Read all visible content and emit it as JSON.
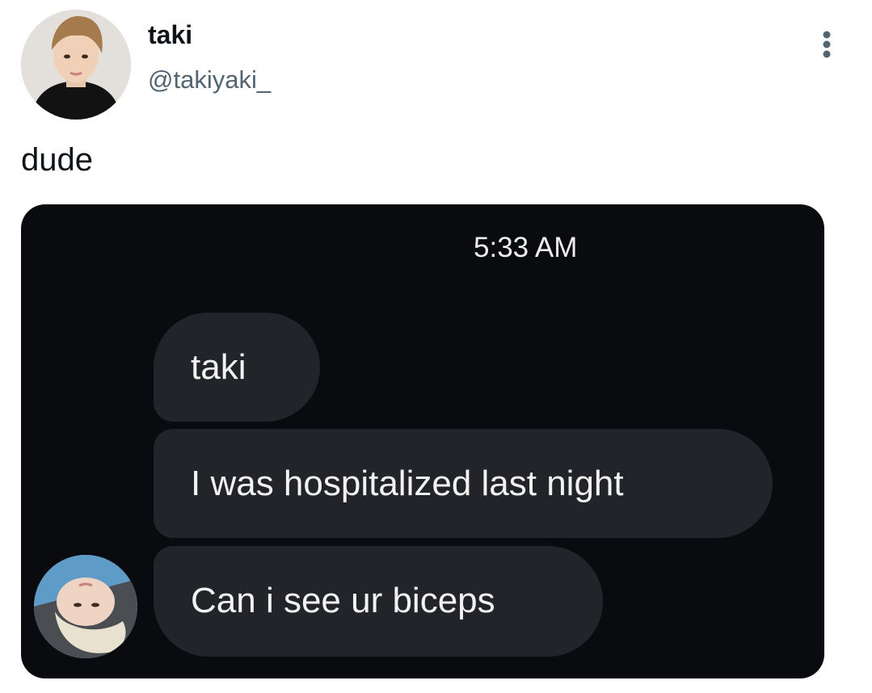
{
  "author": {
    "display_name": "taki",
    "handle": "@takiyaki_",
    "avatar_icon": "user-avatar-icon"
  },
  "tweet": {
    "text": "dude"
  },
  "actions": {
    "more_icon": "more-vertical-icon"
  },
  "screenshot": {
    "timestamp": "5:33 AM",
    "messages": [
      "taki",
      "I was hospitalized last night",
      "Can i see ur biceps"
    ],
    "sender_avatar_icon": "sender-avatar-icon"
  },
  "colors": {
    "display_name": "#0f1419",
    "handle": "#536471",
    "media_bg": "#0a0b0f",
    "bubble_bg": "#23242a",
    "bubble_text": "#f2f2f2"
  }
}
